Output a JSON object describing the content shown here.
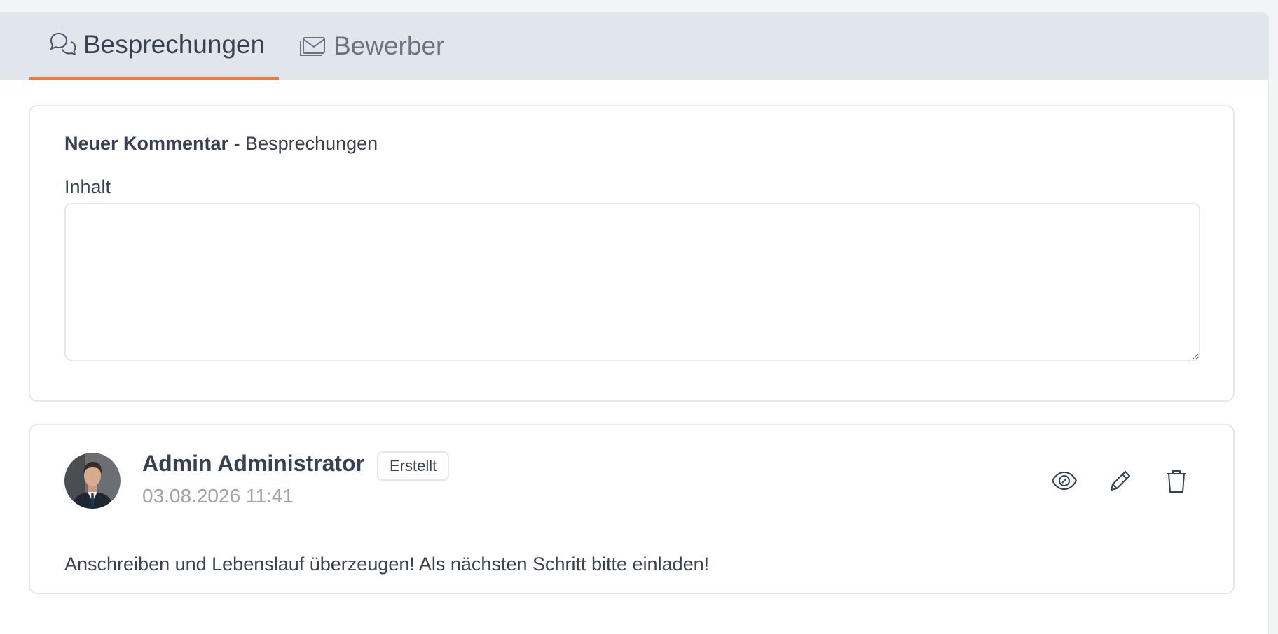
{
  "tabs": [
    {
      "label": "Besprechungen",
      "icon": "chat-bubbles-icon",
      "active": true
    },
    {
      "label": "Bewerber",
      "icon": "envelope-icon",
      "active": false
    }
  ],
  "colors": {
    "accent": "#f07a3a",
    "tabbar_bg": "#e1e5ec",
    "muted_text": "#9ca3af",
    "text": "#374151"
  },
  "form": {
    "title_bold": "Neuer Kommentar",
    "title_rest": " - Besprechungen",
    "content_label": "Inhalt",
    "content_value": "",
    "content_placeholder": ""
  },
  "comment": {
    "author": "Admin Administrator",
    "badge": "Erstellt",
    "date": "03.08.2026 11:41",
    "text": "Anschreiben und Lebenslauf überzeugen! Als nächsten Schritt bitte einladen!",
    "actions": [
      {
        "name": "view",
        "icon": "eye-icon"
      },
      {
        "name": "edit",
        "icon": "pencil-icon"
      },
      {
        "name": "delete",
        "icon": "trash-icon"
      }
    ]
  }
}
